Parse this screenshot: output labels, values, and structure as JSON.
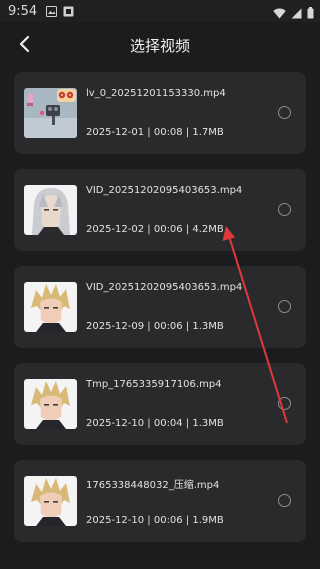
{
  "status_bar": {
    "time": "9:54"
  },
  "header": {
    "title": "选择视频"
  },
  "videos": [
    {
      "name": "lv_0_20251201153330.mp4",
      "meta": "2025-12-01 | 00:08 | 1.7MB",
      "thumb": "thumb-animation"
    },
    {
      "name": "VID_20251202095403653.mp4",
      "meta": "2025-12-02 | 00:06 | 4.2MB",
      "thumb": "thumb-silver-hair"
    },
    {
      "name": "VID_20251202095403653.mp4",
      "meta": "2025-12-09 | 00:06 | 1.3MB",
      "thumb": "thumb-blonde-hair"
    },
    {
      "name": "Tmp_1765335917106.mp4",
      "meta": "2025-12-10 | 00:04 | 1.3MB",
      "thumb": "thumb-blonde-hair"
    },
    {
      "name": "1765338448032_压缩.mp4",
      "meta": "2025-12-10 | 00:06 | 1.9MB",
      "thumb": "thumb-blonde-hair"
    }
  ],
  "annotation": {
    "color": "#e0393a"
  }
}
